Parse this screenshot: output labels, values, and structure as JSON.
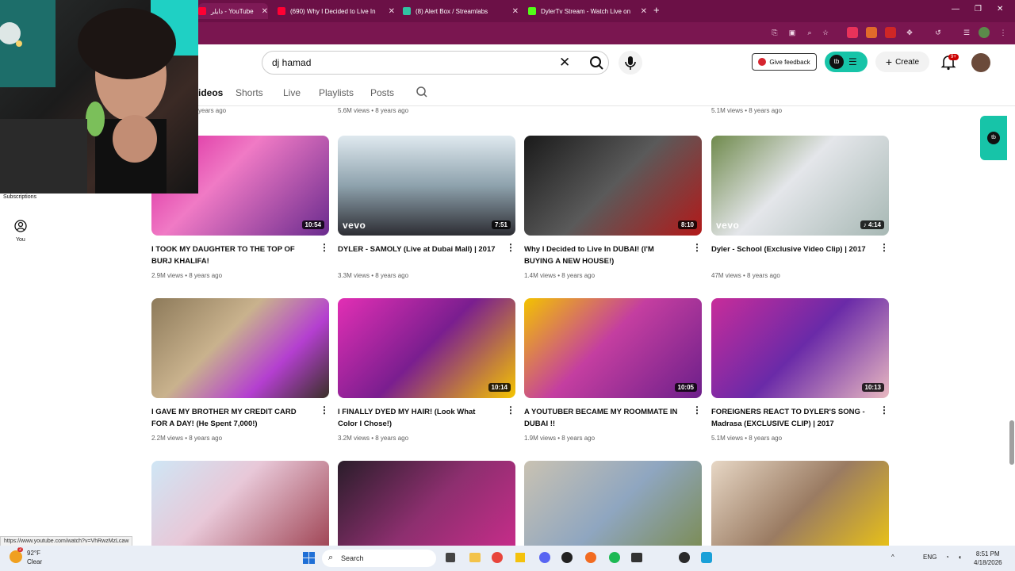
{
  "browser": {
    "tabs": [
      {
        "label": "دايلر - YouTube",
        "color": "#ff0033"
      },
      {
        "label": "(690) Why I Decided to Live In",
        "color": "#ff0033"
      },
      {
        "label": "(8) Alert Box / Streamlabs",
        "color": "#31c3a2"
      },
      {
        "label": "DylerTv Stream - Watch Live on",
        "color": "#53fc18"
      }
    ],
    "new_tab": "+",
    "window_controls": [
      "—",
      "❐",
      "✕"
    ]
  },
  "header": {
    "search_value": "dj hamad",
    "feedback_label": "Give feedback",
    "create_label": "Create",
    "notifications_badge": "9+"
  },
  "channel_tabs": [
    "ideos",
    "Shorts",
    "Live",
    "Playlists",
    "Posts"
  ],
  "top_row_meta": [
    "years ago",
    "5.6M views • 8 years ago",
    "5.1M views • 8 years ago"
  ],
  "sidebar": {
    "subscriptions_label": "Subscriptions",
    "you_label": "You"
  },
  "videos": [
    {
      "title": "I TOOK MY DAUGHTER TO THE TOP OF BURJ KHALIFA!",
      "meta": "2.9M views • 8 years ago",
      "duration": "10:54",
      "thumb": "linear-gradient(135deg,#d8209a,#f07ac5 40%,#6a2b8e)",
      "vevo": ""
    },
    {
      "title": "DYLER - SAMOLY (Live at Dubai Mall) | 2017",
      "meta": "3.3M views • 8 years ago",
      "duration": "7:51",
      "thumb": "linear-gradient(180deg,#dfe9ef,#8ea2ad 50%,#2d2d33)",
      "vevo": "vevo"
    },
    {
      "title": "Why I Decided to Live In DUBAI! (I'M BUYING A NEW HOUSE!)",
      "meta": "1.4M views • 8 years ago",
      "duration": "8:10",
      "thumb": "linear-gradient(135deg,#1a1a1a,#5a5a5a 50%,#b31919)",
      "vevo": ""
    },
    {
      "title": "Dyler - School (Exclusive Video Clip) | 2017",
      "meta": "47M views • 8 years ago",
      "duration": "♪ 4:14",
      "thumb": "linear-gradient(135deg,#6f8a4c,#e4e6ea 45%,#a7b8b4)",
      "vevo": "vevo"
    },
    {
      "title": "I GAVE MY BROTHER MY CREDIT CARD FOR A DAY! (He Spent 7,000!)",
      "meta": "2.2M views • 8 years ago",
      "duration": "",
      "thumb": "linear-gradient(135deg,#8d7a5a,#c9b28d 40%,#b43fd0 70%,#3a3028)",
      "vevo": ""
    },
    {
      "title": "I FINALLY DYED MY HAIR! (Look What Color I Chose!)",
      "meta": "3.2M views • 8 years ago",
      "duration": "10:14",
      "thumb": "linear-gradient(135deg,#e22fb4,#7a1e8f 50%,#f5c400)",
      "vevo": ""
    },
    {
      "title": "A YOUTUBER BECAME MY ROOMMATE IN DUBAI !!",
      "meta": "1.9M views • 8 years ago",
      "duration": "10:05",
      "thumb": "linear-gradient(135deg,#f3c300,#c43ea0 45%,#6c1f8a)",
      "vevo": ""
    },
    {
      "title": "FOREIGNERS REACT TO DYLER'S SONG - Madrasa (EXCLUSIVE CLIP) | 2017",
      "meta": "5.1M views • 8 years ago",
      "duration": "10:13",
      "thumb": "linear-gradient(135deg,#c82c9a,#6a2aa8 50%,#e8b8c0)",
      "vevo": ""
    },
    {
      "title": "",
      "meta": "",
      "duration": "",
      "thumb": "linear-gradient(135deg,#cfe6f5,#e8c8d8 40%,#9a3a4a)",
      "vevo": ""
    },
    {
      "title": "",
      "meta": "",
      "duration": "",
      "thumb": "linear-gradient(135deg,#2a1d2a,#8d2f6f 50%,#cc2c8c)",
      "vevo": ""
    },
    {
      "title": "",
      "meta": "",
      "duration": "",
      "thumb": "linear-gradient(135deg,#c9c2b2,#8fa6c0 50%,#7a8a4c)",
      "vevo": ""
    },
    {
      "title": "",
      "meta": "",
      "duration": "",
      "thumb": "linear-gradient(135deg,#e7d7c5,#9a7b62 50%,#f0c810)",
      "vevo": ""
    }
  ],
  "status_url": "https://www.youtube.com/watch?v=VhRwzMzLcaw",
  "taskbar": {
    "temperature": "92°F",
    "condition": "Clear",
    "search_label": "Search",
    "language": "ENG",
    "time": "8:51 PM",
    "date": "4/18/2026",
    "weather_badge": "2"
  }
}
